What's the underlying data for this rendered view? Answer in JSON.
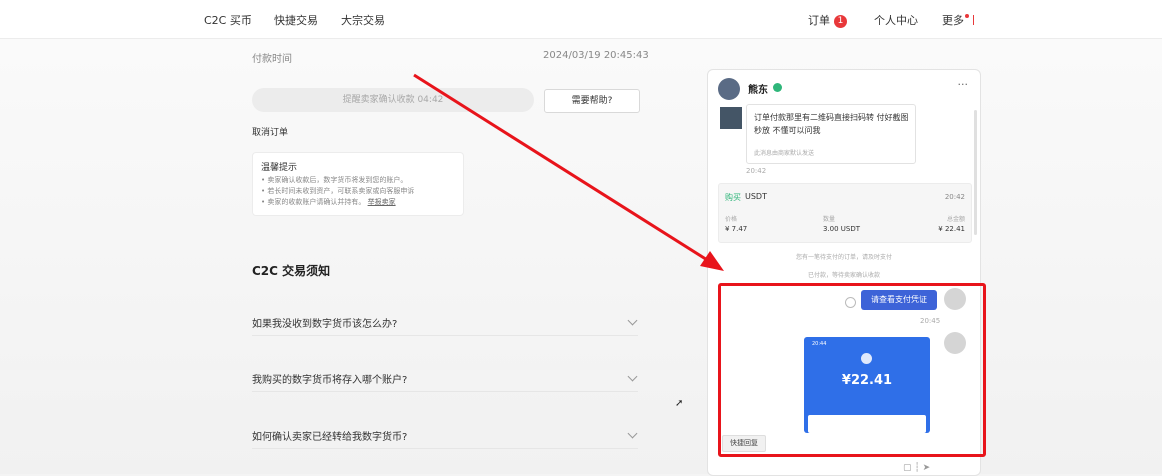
{
  "nav": {
    "left": [
      "C2C 买币",
      "快捷交易",
      "大宗交易"
    ],
    "orders": "订单",
    "orders_badge": "1",
    "personal_center": "个人中心",
    "more": "更多"
  },
  "order": {
    "pay_time_label": "付款时间",
    "pay_time_value": "2024/03/19 20:45:43",
    "remind_button": "提醒卖家确认收款 04:42",
    "help_button": "需要帮助?",
    "cancel_order": "取消订单",
    "tips_title": "温馨提示",
    "tips": [
      "• 卖家确认收款后，数字货币将发到您的账户。",
      "• 若长时间未收到资产，可联系卖家或向客服申诉",
      "• 卖家的收款账户请确认并持有。"
    ],
    "tips_link": "举报卖家"
  },
  "c2c_notice": {
    "title": "C2C 交易须知",
    "faqs": [
      "如果我没收到数字货币该怎么办?",
      "我购买的数字货币将存入哪个账户?",
      "如何确认卖家已经转给我数字货币?"
    ]
  },
  "chat": {
    "name": "熊东",
    "menu": "···",
    "message": "订单付款那里有二维码直接扫码转 付好截图 秒放 不懂可以问我",
    "auto_note": "此消息由商家默认发送",
    "message_time": "20:42",
    "card": {
      "buy": "购买",
      "coin": "USDT",
      "time": "20:42",
      "price_label": "价格",
      "price": "¥ 7.47",
      "qty_label": "数量",
      "qty": "3.00 USDT",
      "total_label": "总金额",
      "total": "¥ 22.41"
    },
    "system1": "您有一笔待支付的订单，请及时支付",
    "system2": "已付款，等待卖家确认收款",
    "sent_message": "请查看支付凭证",
    "sent_time": "20:45",
    "receipt": {
      "status_time": "20:44",
      "amount": "¥22.41"
    },
    "quick_reply": "快捷回复"
  },
  "colors": {
    "highlight": "#e8141b",
    "arrow": "#e8141b",
    "sent_bubble": "#3d63d8",
    "buy_green": "#2fb67a",
    "receipt_blue": "#2f6fe8"
  }
}
